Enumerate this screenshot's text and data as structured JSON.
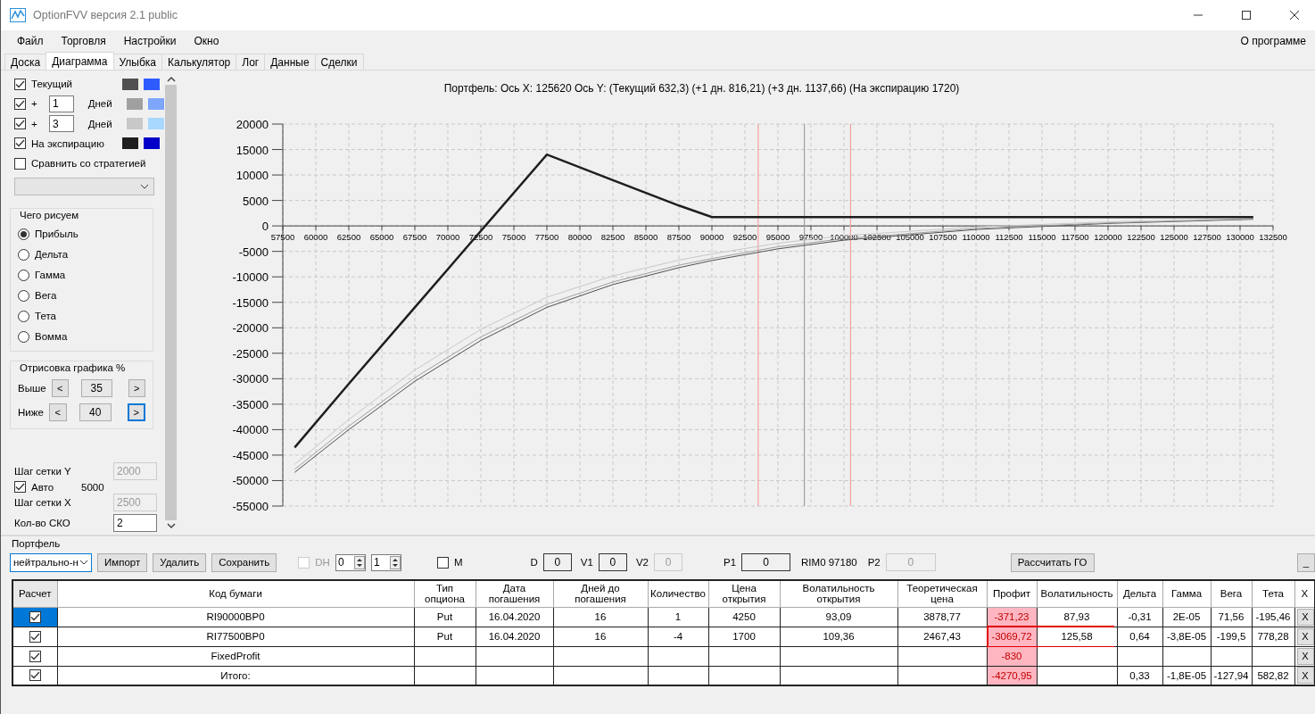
{
  "window": {
    "title": "OptionFVV версия 2.1 public"
  },
  "menu": [
    "Файл",
    "Торговля",
    "Настройки",
    "Окно"
  ],
  "menu_right": "О программе",
  "tabs": [
    {
      "label": "Доска",
      "selected": false
    },
    {
      "label": "Диаграмма",
      "selected": true
    },
    {
      "label": "Улыбка",
      "selected": false
    },
    {
      "label": "Калькулятор",
      "selected": false
    },
    {
      "label": "Лог",
      "selected": false
    },
    {
      "label": "Данные",
      "selected": false
    },
    {
      "label": "Сделки",
      "selected": false
    }
  ],
  "curves": [
    {
      "kind": "fixed",
      "label": "Текущий",
      "checked": true,
      "swatches": [
        {
          "color": "#505050"
        },
        {
          "color": "#2e5bff"
        }
      ]
    },
    {
      "kind": "days",
      "prefix": "+",
      "days": "1",
      "unit": "Дней",
      "checked": true,
      "swatches": [
        {
          "color": "#a0a0a0"
        },
        {
          "color": "#7ea6ff"
        }
      ]
    },
    {
      "kind": "days",
      "prefix": "+",
      "days": "3",
      "unit": "Дней",
      "checked": true,
      "swatches": [
        {
          "color": "#c8c8c8"
        },
        {
          "color": "#a8d8ff"
        }
      ]
    },
    {
      "kind": "fixed",
      "label": "На экспирацию",
      "checked": true,
      "swatches": [
        {
          "color": "#1e1e1e"
        },
        {
          "color": "#0000c8"
        }
      ]
    }
  ],
  "compare": {
    "label": "Сравнить со стратегией",
    "checked": false
  },
  "draw_group": {
    "title": "Чего рисуем",
    "options": [
      {
        "label": "Прибыль",
        "selected": true
      },
      {
        "label": "Дельта",
        "selected": false
      },
      {
        "label": "Гамма",
        "selected": false
      },
      {
        "label": "Вега",
        "selected": false
      },
      {
        "label": "Тета",
        "selected": false
      },
      {
        "label": "Вомма",
        "selected": false
      }
    ]
  },
  "render_group": {
    "title": "Отрисовка графика %",
    "rows": [
      {
        "label": "Выше",
        "dec": "<",
        "value": "35",
        "inc": ">",
        "focused": false
      },
      {
        "label": "Ниже",
        "dec": "<",
        "value": "40",
        "inc": ">",
        "focused": true
      }
    ]
  },
  "grid_settings": [
    {
      "kind": "field",
      "label": "Шаг сетки Y",
      "value": "2000",
      "disabled": true
    },
    {
      "kind": "check",
      "label": "Авто",
      "checked": true,
      "value": "5000"
    },
    {
      "kind": "field",
      "label": "Шаг сетки X",
      "value": "2500",
      "disabled": true
    },
    {
      "kind": "field",
      "label": "Кол-во СКО",
      "value": "2",
      "disabled": false
    }
  ],
  "chart": {
    "chart_data": {
      "type": "line",
      "title": "Портфель: Ось X: 125620 Ось Y:  (Текущий 632,3)  (+1 дн. 816,21)  (+3 дн. 1137,66)  (На экспирацию 1720)",
      "x": [
        58400,
        62500,
        67500,
        72500,
        77500,
        82500,
        87500,
        90000,
        95000,
        100000,
        110000,
        120000,
        131000
      ],
      "series": [
        {
          "color": "#505050",
          "line_style": "solid",
          "values": [
            -48400,
            -40000,
            -30500,
            -22500,
            -16000,
            -11500,
            -8200,
            -6800,
            -4500,
            -2800,
            -700,
            500,
            1300
          ]
        },
        {
          "color": "#a0a0a0",
          "line_style": "solid",
          "values": [
            -47800,
            -39300,
            -29800,
            -21800,
            -15400,
            -11000,
            -7700,
            -6400,
            -4100,
            -2500,
            -500,
            600,
            1400
          ]
        },
        {
          "color": "#c8c8c8",
          "line_style": "solid",
          "values": [
            -46800,
            -38000,
            -28300,
            -20300,
            -14000,
            -9800,
            -6700,
            -5500,
            -3400,
            -1900,
            -200,
            800,
            1500
          ]
        },
        {
          "color": "#1e1e1e",
          "line_style": "solid",
          "values": [
            -43500,
            -31000,
            -16000,
            -1000,
            14000,
            9000,
            4000,
            1720,
            1720,
            1720,
            1720,
            1720,
            1720
          ]
        }
      ],
      "xlim": [
        57500,
        132500
      ],
      "ylim": [
        -55000,
        20000
      ],
      "grid": true,
      "xticks": [
        57500,
        60000,
        62500,
        65000,
        67500,
        70000,
        72500,
        75000,
        77500,
        80000,
        82500,
        85000,
        87500,
        90000,
        92500,
        95000,
        97500,
        100000,
        102500,
        105000,
        107500,
        110000,
        112500,
        115000,
        117500,
        120000,
        122500,
        125000,
        127500,
        130000,
        132500
      ],
      "yticks": [
        20000,
        15000,
        10000,
        5000,
        0,
        -5000,
        -10000,
        -15000,
        -20000,
        -25000,
        -30000,
        -35000,
        -40000,
        -45000,
        -50000,
        -55000
      ],
      "ref_lines": [
        {
          "axis": "x",
          "value": 93500,
          "color": "#f4a0a0"
        },
        {
          "axis": "x",
          "value": 97000,
          "color": "#a0a0a0"
        },
        {
          "axis": "x",
          "value": 100500,
          "color": "#f4a0a0"
        }
      ]
    }
  },
  "portfolio": {
    "title": "Портфель",
    "strategy": "нейтрально-н",
    "buttons": [
      "Импорт",
      "Удалить",
      "Сохранить"
    ],
    "dh": {
      "label": "DH",
      "checked": false,
      "disabled": true
    },
    "spin1": "0",
    "spin2": "1",
    "m": {
      "label": "M",
      "checked": false
    },
    "fields": [
      {
        "label": "D",
        "value": "0",
        "disabled": false
      },
      {
        "label": "V1",
        "value": "0",
        "disabled": false
      },
      {
        "label": "V2",
        "value": "0",
        "disabled": true
      },
      {
        "label": "P1",
        "value": "0",
        "disabled": false
      }
    ],
    "quote": "RIM0 97180",
    "p2": {
      "label": "P2",
      "value": "0",
      "disabled": true
    },
    "calc_button": "Рассчитать ГО",
    "collapse_button": "_"
  },
  "table": {
    "columns": [
      "Расчет",
      "Код бумаги",
      "Тип опциона",
      "Дата погашения",
      "Дней до погашения",
      "Количество",
      "Цена открытия",
      "Волатильность открытия",
      "Теоретическая цена",
      "Профит",
      "Волатильность",
      "Дельта",
      "Гамма",
      "Вега",
      "Тета",
      "X"
    ],
    "rows": [
      {
        "checked": true,
        "selected": true,
        "profit_highlighted": true,
        "outlined": false,
        "cells": [
          "",
          "RI90000BP0",
          "Put",
          "16.04.2020",
          "16",
          "1",
          "4250",
          "93,09",
          "3878,77",
          "-371,23",
          "87,93",
          "-0,31",
          "2E-05",
          "71,56",
          "-195,46",
          "X"
        ]
      },
      {
        "checked": true,
        "selected": false,
        "profit_highlighted": true,
        "outlined": true,
        "cells": [
          "",
          "RI77500BP0",
          "Put",
          "16.04.2020",
          "16",
          "-4",
          "1700",
          "109,36",
          "2467,43",
          "-3069,72",
          "125,58",
          "0,64",
          "-3,8E-05",
          "-199,5",
          "778,28",
          "X"
        ]
      },
      {
        "checked": true,
        "selected": false,
        "profit_highlighted": true,
        "outlined": false,
        "cells": [
          "",
          "FixedProfit",
          "",
          "",
          "",
          "",
          "",
          "",
          "",
          "-830",
          "",
          "",
          "",
          "",
          "",
          "X"
        ]
      },
      {
        "checked": true,
        "selected": false,
        "profit_highlighted": true,
        "outlined": false,
        "cells": [
          "",
          "Итого:",
          "",
          "",
          "",
          "",
          "",
          "",
          "",
          "-4270,95",
          "",
          "0,33",
          "-1,8E-05",
          "-127,94",
          "582,82",
          "X"
        ]
      }
    ]
  }
}
